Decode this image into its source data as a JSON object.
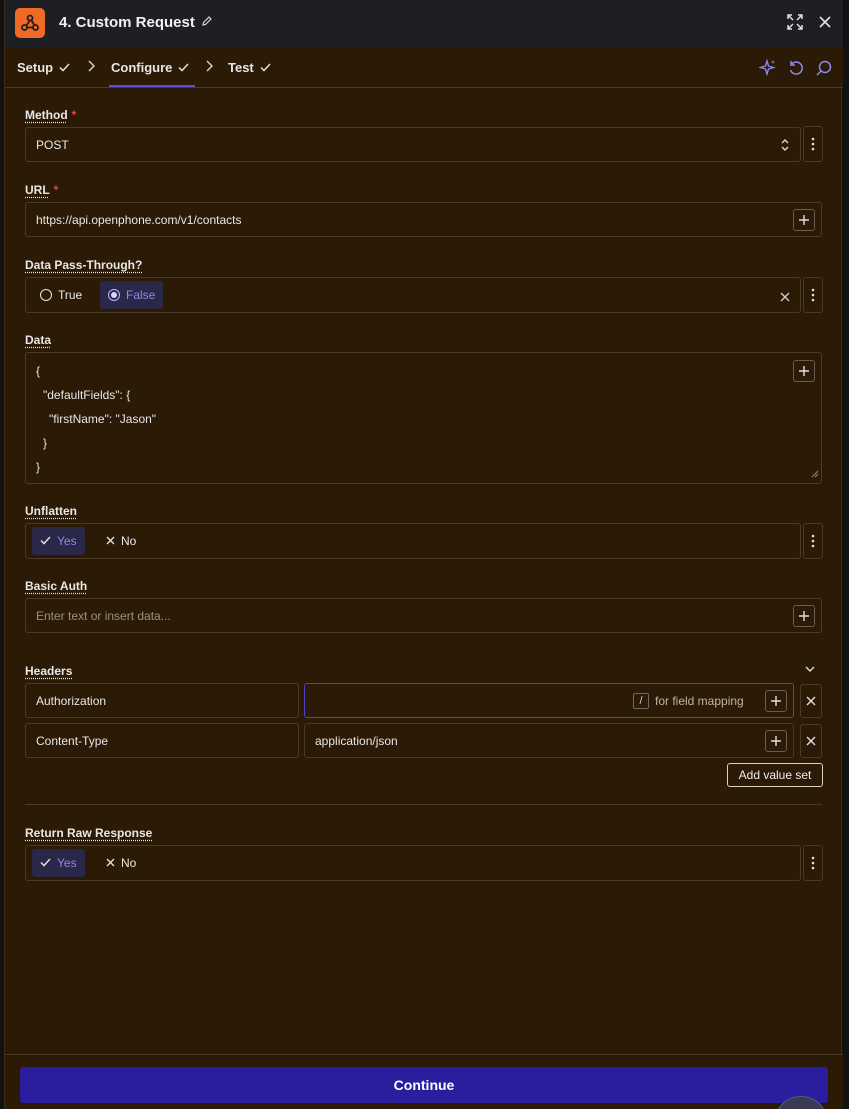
{
  "window": {
    "title": "4. Custom Request"
  },
  "steps": [
    {
      "label": "Setup"
    },
    {
      "label": "Configure"
    },
    {
      "label": "Test"
    }
  ],
  "method": {
    "label": "Method",
    "required_mark": "*",
    "value": "POST"
  },
  "url": {
    "label": "URL",
    "required_mark": "*",
    "value": "https://api.openphone.com/v1/contacts"
  },
  "pass_through": {
    "label": "Data Pass-Through?",
    "option_true": "True",
    "option_false": "False",
    "selected": "False"
  },
  "data": {
    "label": "Data",
    "lines": [
      "{",
      "\"defaultFields\": {",
      "\"firstName\": \"Jason\"",
      "}",
      "}"
    ]
  },
  "unflatten": {
    "label": "Unflatten",
    "option_yes": "Yes",
    "option_no": "No",
    "selected": "Yes"
  },
  "basic_auth": {
    "label": "Basic Auth",
    "placeholder": "Enter text or insert data..."
  },
  "headers": {
    "label": "Headers",
    "rows": [
      {
        "key": "Authorization",
        "value": "",
        "hint_key": "/",
        "hint": "for field mapping"
      },
      {
        "key": "Content-Type",
        "value": "application/json"
      }
    ],
    "add_label": "Add value set"
  },
  "raw_response": {
    "label": "Return Raw Response",
    "option_yes": "Yes",
    "option_no": "No",
    "selected": "Yes"
  },
  "footer": {
    "continue_label": "Continue"
  },
  "colors": {
    "panel_bg": "#2b1a05",
    "accent": "#5b4ce0",
    "button": "#2a1e9e",
    "brand": "#f06a25"
  }
}
